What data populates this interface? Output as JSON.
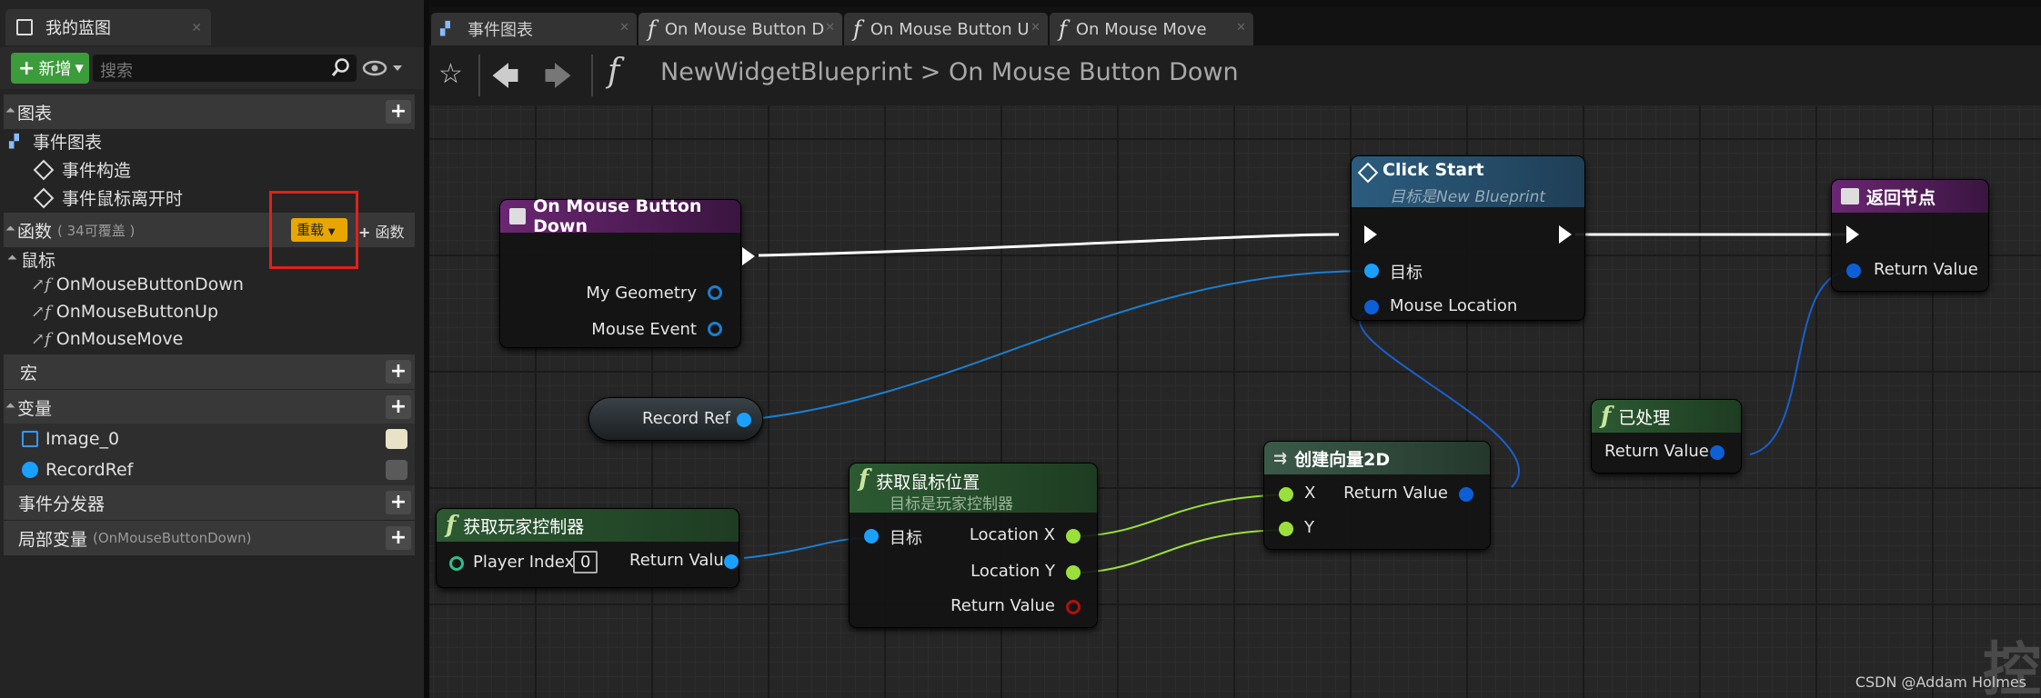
{
  "left_panel": {
    "tab_title": "我的蓝图",
    "new_button": "新增",
    "search_placeholder": "搜索",
    "sections": {
      "graphs": "图表",
      "event_graph": "事件图表",
      "event_construct": "事件构造",
      "event_mouse_leave": "事件鼠标离开时",
      "functions": "函数",
      "functions_sub": "( 34可覆盖 )",
      "override_button": "重载",
      "add_function_button": "函数",
      "mouse_category": "鼠标",
      "fn_items": [
        "OnMouseButtonDown",
        "OnMouseButtonUp",
        "OnMouseMove"
      ],
      "macros": "宏",
      "variables": "变量",
      "vars": [
        "Image_0",
        "RecordRef"
      ],
      "dispatchers": "事件分发器",
      "local_vars": "局部变量",
      "local_vars_sub": "(OnMouseButtonDown)"
    }
  },
  "graph_tabs": [
    "事件图表",
    "On Mouse Button D",
    "On Mouse Button U",
    "On Mouse Move"
  ],
  "breadcrumb": {
    "blueprint": "NewWidgetBlueprint",
    "sep": ">",
    "function": "On Mouse Button Down"
  },
  "nodes": {
    "mouse_down": {
      "title": "On Mouse Button Down",
      "pins": [
        "My Geometry",
        "Mouse Event"
      ]
    },
    "click_start": {
      "title": "Click Start",
      "subtitle_prefix": "目标是",
      "subtitle_target": "New Blueprint",
      "pins": [
        "目标",
        "Mouse Location"
      ]
    },
    "return_node": {
      "title": "返回节点",
      "pins": [
        "Return Value"
      ]
    },
    "record_ref": {
      "title": "Record Ref"
    },
    "get_pc": {
      "title": "获取玩家控制器",
      "pin_in": "Player Index",
      "pin_in_value": "0",
      "pin_out": "Return Value"
    },
    "get_mouse": {
      "title": "获取鼠标位置",
      "subtitle": "目标是玩家控制器",
      "pin_in": "目标",
      "pins_out": [
        "Location X",
        "Location Y",
        "Return Value"
      ]
    },
    "make_vec": {
      "title": "创建向量2D",
      "pins_in": [
        "X",
        "Y"
      ],
      "pin_out": "Return Value"
    },
    "handled": {
      "title": "已处理",
      "pin_out": "Return Value"
    }
  },
  "watermark": "CSDN @Addam Holmes",
  "colors": {
    "accent_green": "#3c9b3a",
    "override": "#e8a700",
    "highlight": "#e0201c"
  }
}
